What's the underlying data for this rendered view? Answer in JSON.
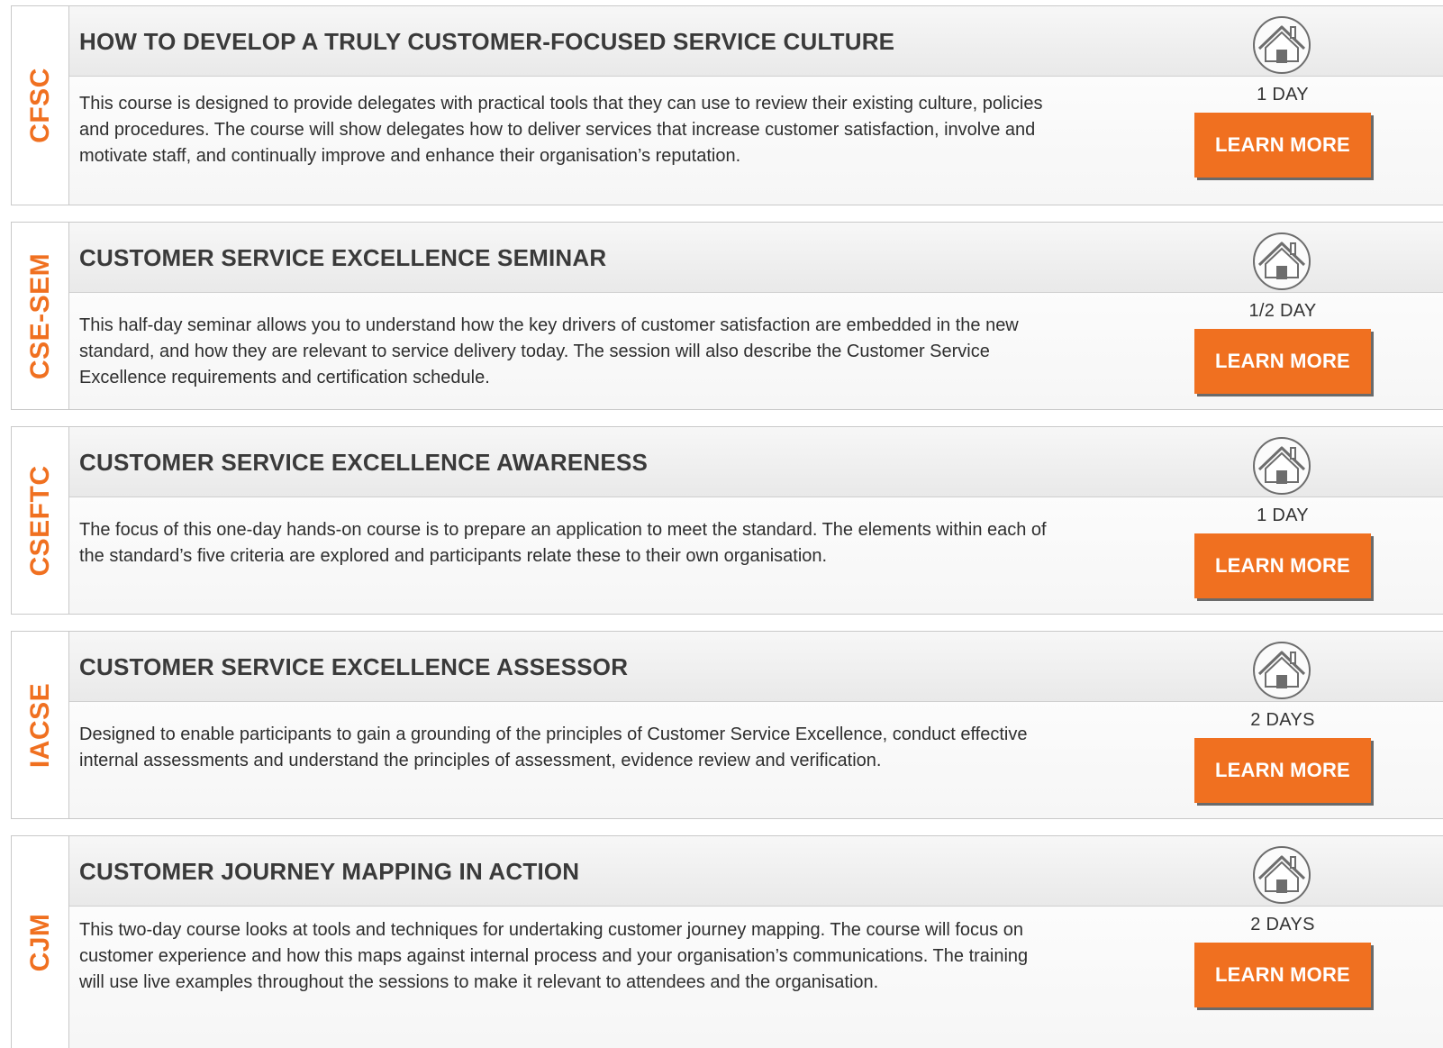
{
  "courses": [
    {
      "code": "CFSC",
      "title": "HOW TO DEVELOP A TRULY CUSTOMER-FOCUSED SERVICE CULTURE",
      "description": "This course is designed to provide delegates with practical tools that they can use to review their existing culture, policies and procedures. The course will show delegates how to deliver services that increase customer satisfaction, involve and motivate staff, and continually improve and enhance their organisation’s reputation.",
      "duration": "1 DAY",
      "button_label": "LEARN MORE",
      "icon": "home-icon"
    },
    {
      "code": "CSE-SEM",
      "title": "CUSTOMER SERVICE EXCELLENCE SEMINAR",
      "description": "This half-day seminar allows you to understand how the key drivers of customer satisfaction are embedded in the new standard, and how they are relevant to service delivery today. The session will also describe the Customer Service Excellence requirements and certification schedule.",
      "duration": "1/2 DAY",
      "button_label": "LEARN MORE",
      "icon": "home-icon"
    },
    {
      "code": "CSEFTC",
      "title": "CUSTOMER SERVICE EXCELLENCE AWARENESS",
      "description": "The focus of this one-day hands-on course is to prepare an application to meet the standard. The elements within each of the standard’s five criteria are explored and participants relate these to their own organisation.",
      "duration": "1 DAY",
      "button_label": "LEARN MORE",
      "icon": "home-icon"
    },
    {
      "code": "IACSE",
      "title": "CUSTOMER SERVICE EXCELLENCE ASSESSOR",
      "description": "Designed to enable participants to gain a grounding of the principles of Customer Service Excellence, conduct effective internal assessments and understand the principles of assessment, evidence review and verification.",
      "duration": "2 DAYS",
      "button_label": "LEARN MORE",
      "icon": "home-icon"
    },
    {
      "code": "CJM",
      "title": "CUSTOMER JOURNEY MAPPING IN ACTION",
      "description": "This two-day course looks at tools and techniques for undertaking customer journey mapping. The course will focus on customer experience and how this maps against internal process and your organisation’s communications. The training will use live examples throughout the sessions to make it relevant to attendees and the organisation.",
      "duration": "2 DAYS",
      "button_label": "LEARN MORE",
      "icon": "home-icon"
    }
  ],
  "colors": {
    "accent": "#f07020",
    "border": "#c9c9c9",
    "icon_gray": "#6d6d6d"
  }
}
